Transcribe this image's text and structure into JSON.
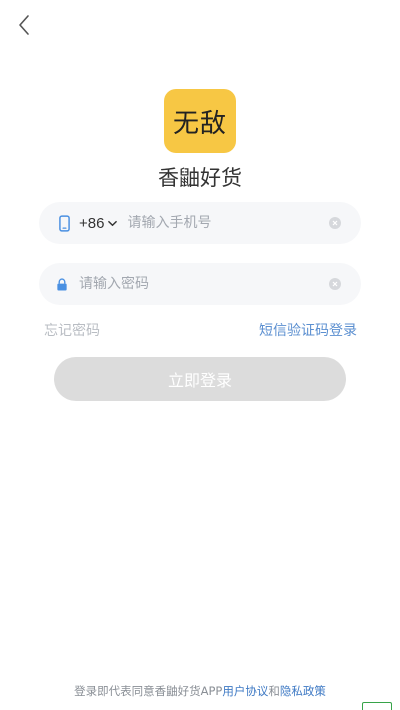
{
  "header": {
    "back_icon": "chevron-left-icon"
  },
  "logo": {
    "text": "无敌",
    "bg_color": "#f7c744"
  },
  "app_name": "香鼬好货",
  "phone_field": {
    "device_icon": "phone-icon",
    "country_code": "+86",
    "country_chevron": "chevron-down-icon",
    "placeholder": "请输入手机号",
    "value": "",
    "clear_icon": "clear-icon"
  },
  "password_field": {
    "lock_icon": "lock-icon",
    "placeholder": "请输入密码",
    "value": "",
    "clear_icon": "clear-icon"
  },
  "links": {
    "forgot": "忘记密码",
    "sms_login": "短信验证码登录"
  },
  "login_button": "立即登录",
  "agreement": {
    "prefix": "登录即代表同意香鼬好货APP",
    "user_agreement": "用户协议",
    "and": "和",
    "privacy_policy": "隐私政策"
  },
  "colors": {
    "accent": "#5b8fd0",
    "link": "#3e79c4",
    "input_bg": "#f6f7f9",
    "button_disabled": "#dcdcdc",
    "icon_blue": "#4a90e2"
  }
}
